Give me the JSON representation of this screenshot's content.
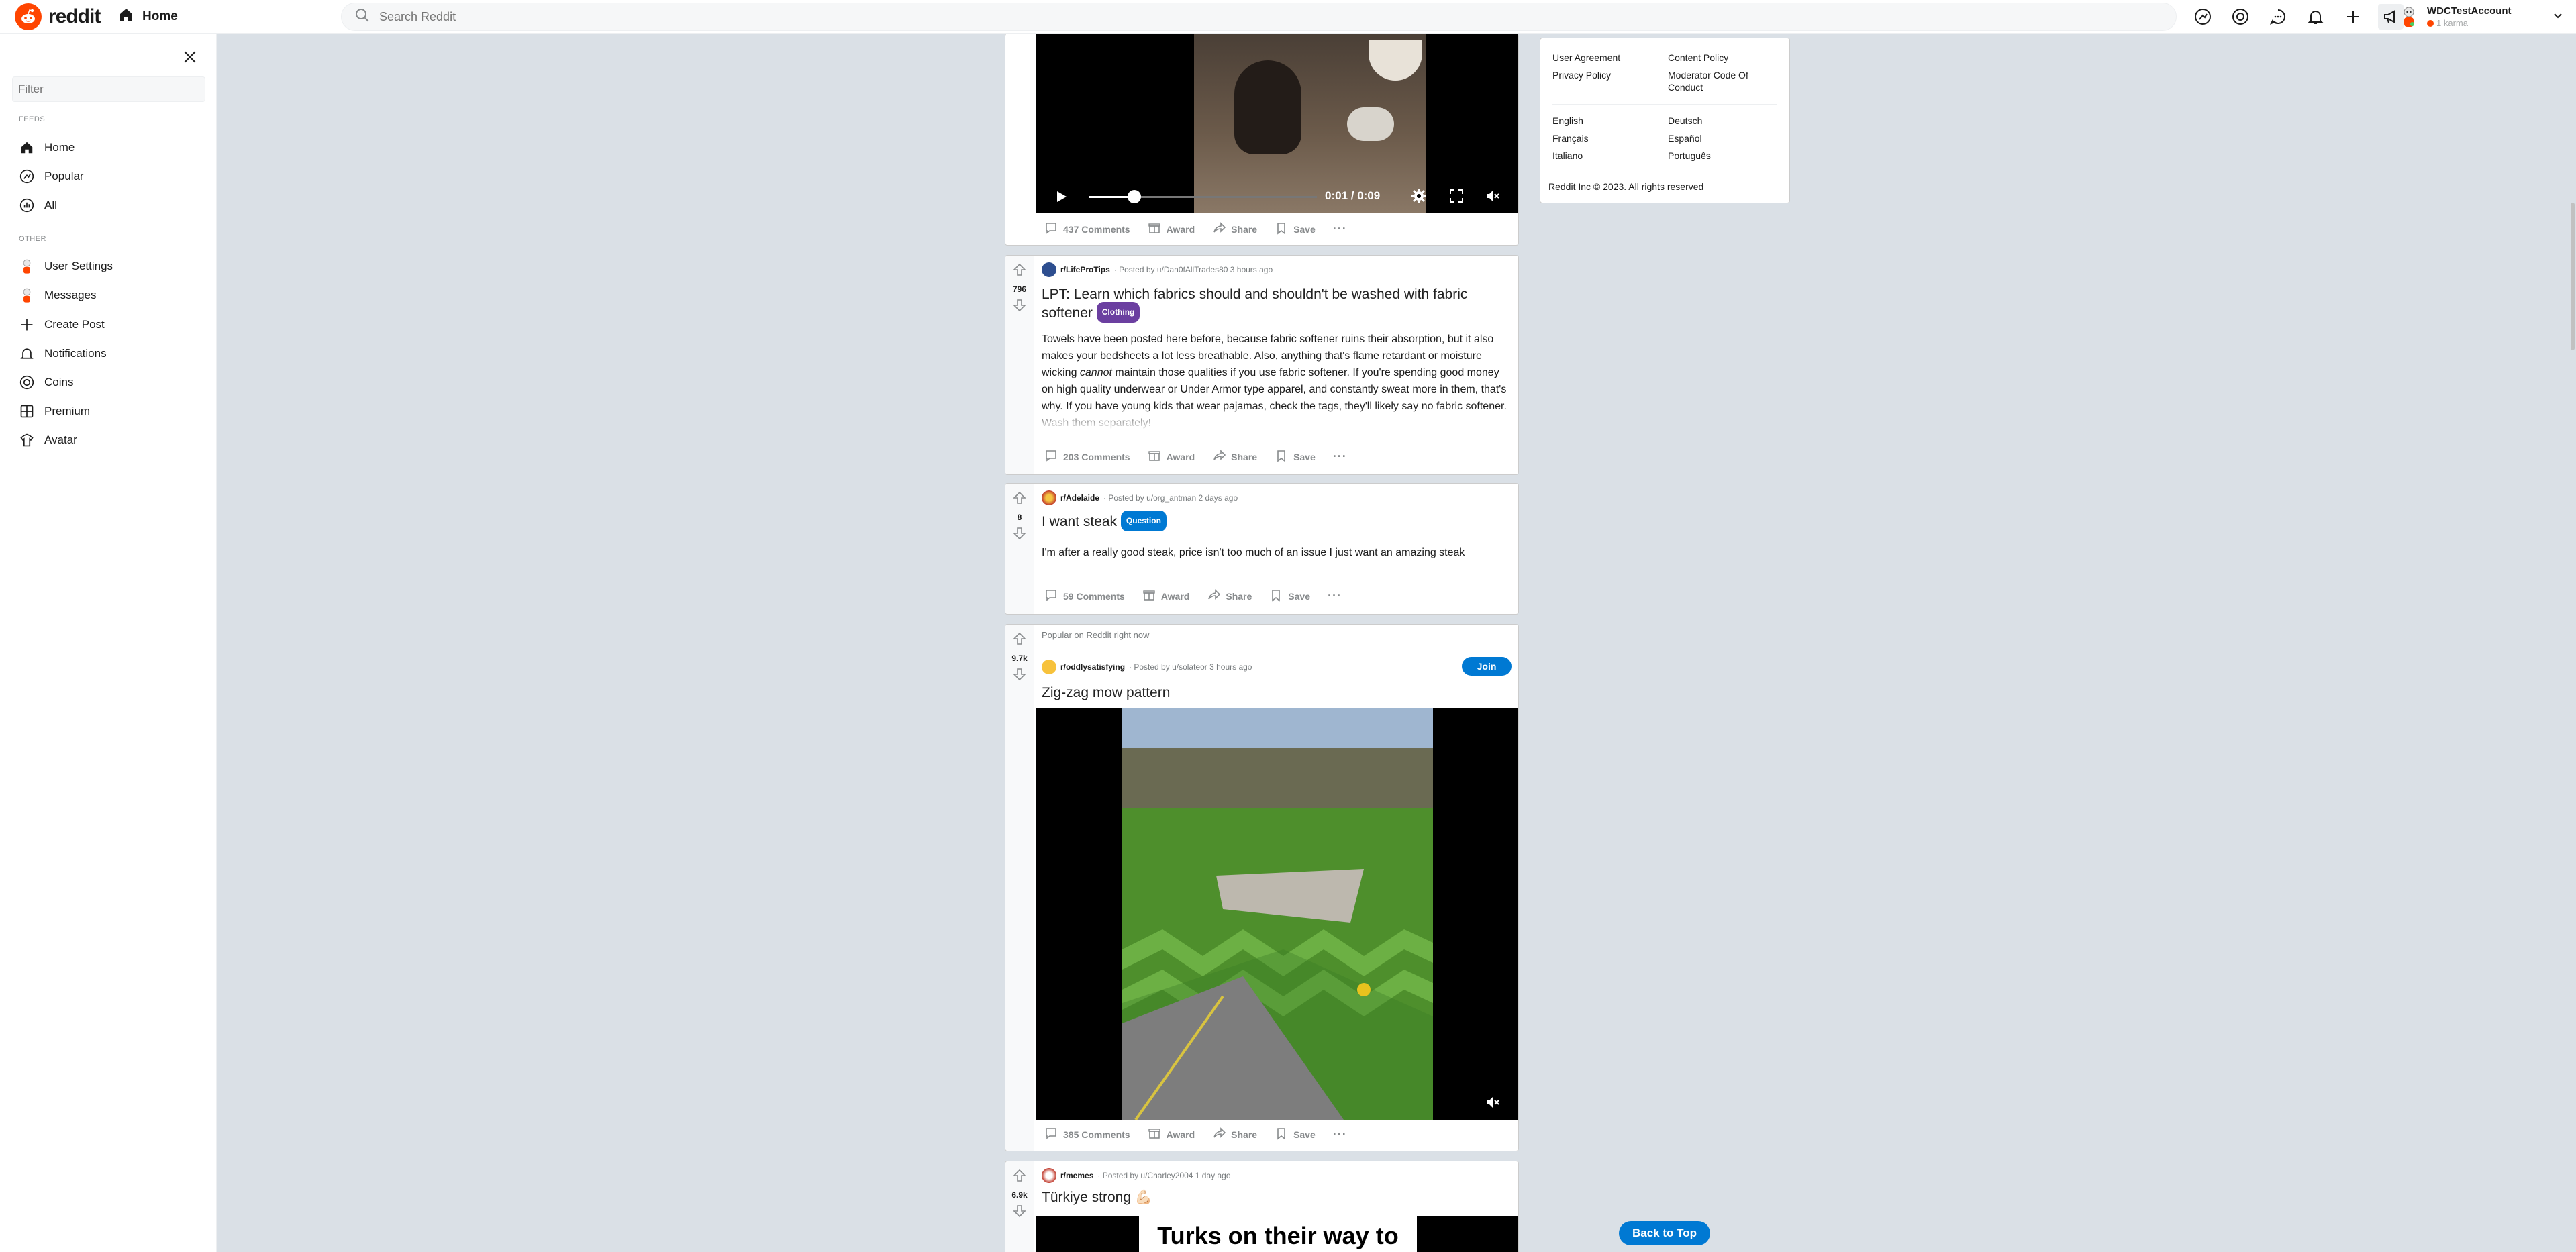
{
  "header": {
    "logo_text": "reddit",
    "home_label": "Home",
    "search_placeholder": "Search Reddit",
    "username": "WDCTestAccount",
    "karma": "1 karma"
  },
  "sidebar": {
    "filter_placeholder": "Filter",
    "feeds_heading": "FEEDS",
    "feeds": [
      {
        "label": "Home"
      },
      {
        "label": "Popular"
      },
      {
        "label": "All"
      }
    ],
    "other_heading": "OTHER",
    "other": [
      {
        "label": "User Settings"
      },
      {
        "label": "Messages"
      },
      {
        "label": "Create Post"
      },
      {
        "label": "Notifications"
      },
      {
        "label": "Coins"
      },
      {
        "label": "Premium"
      },
      {
        "label": "Avatar"
      }
    ]
  },
  "posts": [
    {
      "video": {
        "time": "0:01 / 0:09",
        "progress": 0.2
      },
      "comments": "437 Comments",
      "award": "Award",
      "share": "Share",
      "save": "Save"
    },
    {
      "votes": "796",
      "subreddit": "r/LifeProTips",
      "posted_by": "· Posted by u/Dan0fAllTrades80 3 hours ago",
      "title": "LPT: Learn which fabrics should and shouldn't be washed with fabric softener",
      "flair": "Clothing",
      "flair_color": "#6b3fa0",
      "text_before": "Towels have been posted here before, because fabric softener ruins their absorption, but it also makes your bedsheets a lot less breathable. Also, anything that's flame retardant or moisture wicking ",
      "text_em": "cannot",
      "text_after": " maintain those qualities if you use fabric softener. If you're spending good money on high quality underwear or Under Armor type apparel, and constantly sweat more in them, that's why. If you have young kids that wear pajamas, check the tags, they'll likely say no fabric softener. Wash them separately!",
      "comments": "203 Comments",
      "award": "Award",
      "share": "Share",
      "save": "Save"
    },
    {
      "votes": "8",
      "subreddit": "r/Adelaide",
      "posted_by": "· Posted by u/org_antman 2 days ago",
      "title": "I want steak",
      "flair": "Question",
      "flair_color": "#0079d3",
      "text": "I'm after a really good steak, price isn't too much of an issue I just want an amazing steak",
      "comments": "59 Comments",
      "award": "Award",
      "share": "Share",
      "save": "Save"
    },
    {
      "votes": "9.7k",
      "popular_label": "Popular on Reddit right now",
      "subreddit": "r/oddlysatisfying",
      "posted_by": "· Posted by u/solateor 3 hours ago",
      "join": "Join",
      "title": "Zig-zag mow pattern",
      "comments": "385 Comments",
      "award": "Award",
      "share": "Share",
      "save": "Save"
    },
    {
      "votes": "6.9k",
      "subreddit": "r/memes",
      "posted_by": "· Posted by u/Charley2004 1 day ago",
      "title": "Türkiye strong 💪🏻",
      "meme_text": "Turks on their way to"
    }
  ],
  "footer": {
    "links_col1": [
      "User Agreement",
      "Privacy Policy"
    ],
    "links_col2": [
      "Content Policy",
      "Moderator Code Of Conduct"
    ],
    "langs_col1": [
      "English",
      "Français",
      "Italiano"
    ],
    "langs_col2": [
      "Deutsch",
      "Español",
      "Português"
    ],
    "copyright": "Reddit Inc © 2023. All rights reserved"
  },
  "back_to_top": "Back to Top",
  "colors": {
    "brand": "#ff4500",
    "accent": "#0079d3"
  }
}
